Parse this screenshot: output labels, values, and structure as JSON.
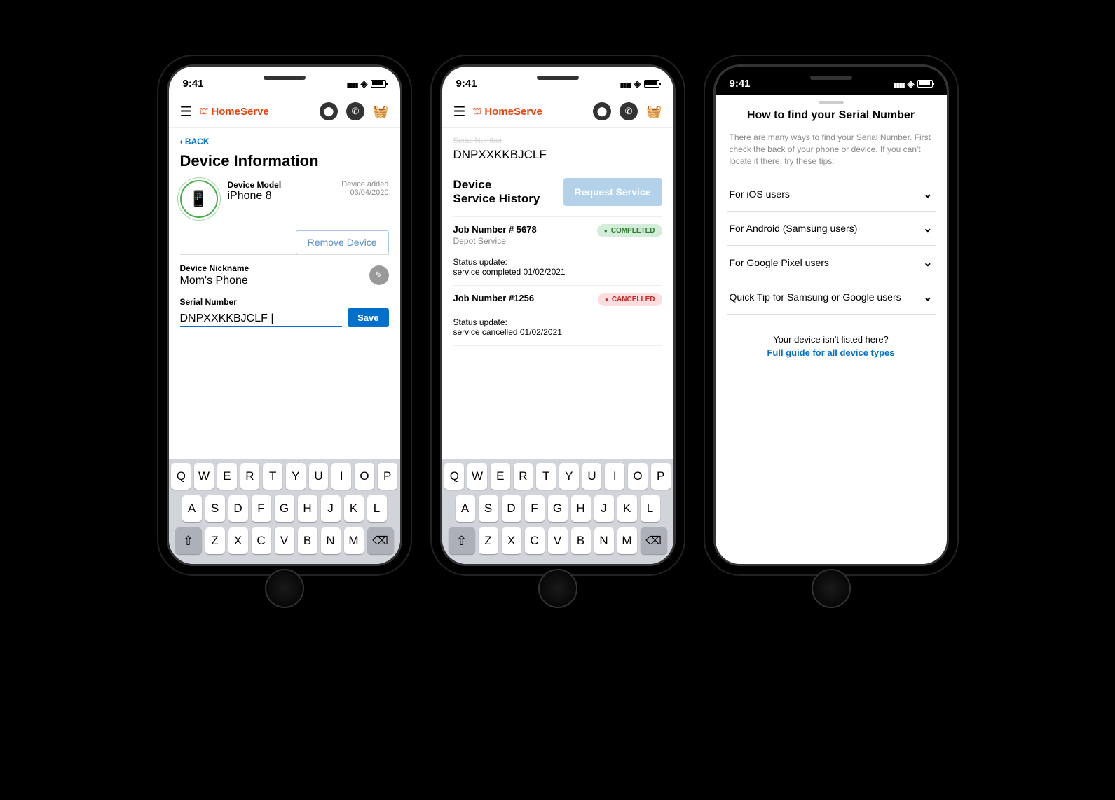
{
  "status_time": "9:41",
  "brand": "HomeServe",
  "phone1": {
    "back": "BACK",
    "title": "Device Information",
    "model_label": "Device Model",
    "model_value": "iPhone 8",
    "added_label": "Device added",
    "added_date": "03/04/2020",
    "remove_btn": "Remove Device",
    "nickname_label": "Device Nickname",
    "nickname_value": "Mom's Phone",
    "serial_label": "Serial Number",
    "serial_value": "DNPXXKKBJCLF",
    "save_btn": "Save"
  },
  "phone2": {
    "serial_label_cut": "Serial Number",
    "serial_value": "DNPXXKKBJCLF",
    "section_title_l1": "Device",
    "section_title_l2": "Service History",
    "request_btn": "Request Service",
    "jobs": [
      {
        "number": "Job Number # 5678",
        "type": "Depot Service",
        "status_label": "COMPLETED",
        "status_class": "completed",
        "update_label": "Status update:",
        "update_text": "service completed 01/02/2021"
      },
      {
        "number": "Job Number #1256",
        "type": "",
        "status_label": "CANCELLED",
        "status_class": "cancelled",
        "update_label": "Status update:",
        "update_text": "service cancelled 01/02/2021"
      }
    ]
  },
  "phone3": {
    "title": "How to find your Serial Number",
    "intro": "There are many ways to find your Serial Number. First check the back of your phone or device. If you can't locate it there, try these tips:",
    "items": [
      "For iOS users",
      "For Android (Samsung users)",
      "For Google Pixel users",
      "Quick Tip for Samsung or Google users"
    ],
    "footer_q": "Your device isn't listed here?",
    "footer_link": "Full guide for all device types"
  },
  "keyboard": {
    "row1": [
      "Q",
      "W",
      "E",
      "R",
      "T",
      "Y",
      "U",
      "I",
      "O",
      "P"
    ],
    "row2": [
      "A",
      "S",
      "D",
      "F",
      "G",
      "H",
      "J",
      "K",
      "L"
    ],
    "row3": [
      "Z",
      "X",
      "C",
      "V",
      "B",
      "N",
      "M"
    ]
  }
}
